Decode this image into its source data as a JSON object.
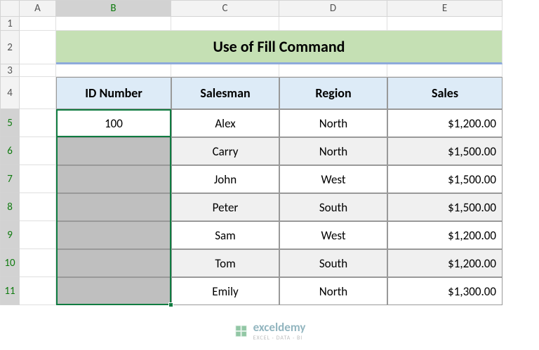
{
  "columns": [
    "A",
    "B",
    "C",
    "D",
    "E"
  ],
  "col_widths": {
    "A": 52,
    "B": 164,
    "C": 154,
    "D": 154,
    "E": 164
  },
  "active_col": "B",
  "rows": [
    "1",
    "2",
    "3",
    "4",
    "5",
    "6",
    "7",
    "8",
    "9",
    "10",
    "11"
  ],
  "row_heights": {
    "1": 20,
    "2": 48,
    "3": 18,
    "4": 46,
    "5": 40,
    "6": 40,
    "7": 40,
    "8": 40,
    "9": 40,
    "10": 40,
    "11": 40
  },
  "active_rows": [
    "5",
    "6",
    "7",
    "8",
    "9",
    "10",
    "11"
  ],
  "title": "Use of Fill Command",
  "headers": {
    "id": "ID Number",
    "salesman": "Salesman",
    "region": "Region",
    "sales": "Sales"
  },
  "data": [
    {
      "id": "100",
      "salesman": "Alex",
      "region": "North",
      "sales": "$1,200.00"
    },
    {
      "id": "",
      "salesman": "Carry",
      "region": "North",
      "sales": "$1,500.00"
    },
    {
      "id": "",
      "salesman": "John",
      "region": "West",
      "sales": "$1,500.00"
    },
    {
      "id": "",
      "salesman": "Peter",
      "region": "South",
      "sales": "$1,500.00"
    },
    {
      "id": "",
      "salesman": "Sam",
      "region": "West",
      "sales": "$1,200.00"
    },
    {
      "id": "",
      "salesman": "Tom",
      "region": "South",
      "sales": "$1,200.00"
    },
    {
      "id": "",
      "salesman": "Emily",
      "region": "North",
      "sales": "$1,300.00"
    }
  ],
  "watermark": {
    "brand": "exceldemy",
    "sub": "EXCEL · DATA · BI"
  }
}
